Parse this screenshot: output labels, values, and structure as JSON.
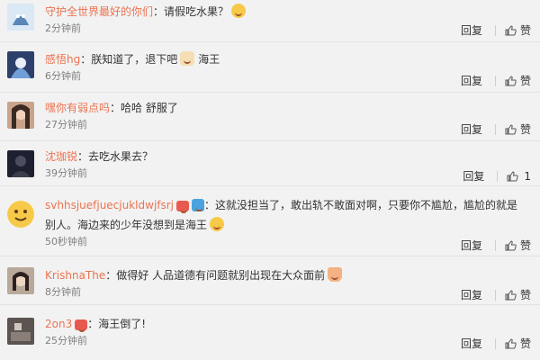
{
  "comments": [
    {
      "username": "守护全世界最好的你们",
      "text": "：请假吃水果？",
      "emojis": [
        "grin-emoji"
      ],
      "time": "2分钟前",
      "reply_label": "回复",
      "like_label": "赞",
      "avatar": "blue-cartoon-avatar"
    },
    {
      "username": "感悟hg",
      "text": "：朕知道了，退下吧",
      "emojis": [
        "dog-emoji"
      ],
      "text_after": "海王",
      "time": "6分钟前",
      "reply_label": "回复",
      "like_label": "赞",
      "avatar": "anime-avatar"
    },
    {
      "username": "嘿你有弱点吗",
      "text": "：哈哈 舒服了",
      "time": "27分钟前",
      "reply_label": "回复",
      "like_label": "赞",
      "avatar": "girl-avatar"
    },
    {
      "username": "沈珈锐",
      "text": "：去吃水果去？",
      "time": "39分钟前",
      "reply_label": "回复",
      "like_label": "",
      "like_count": "1",
      "avatar": "dark-avatar"
    },
    {
      "username": "svhhsjuefjuecjukldwjfsrj",
      "text": "：这就没担当了，敢出轨不敢面对啊，只要你不尴尬，尴尬的就是",
      "text_line2": "别人。海边来的少年没想到是海王",
      "time": "50秒钟前",
      "reply_label": "回复",
      "like_label": "赞",
      "avatar": "emoji-avatar"
    },
    {
      "username": "KrishnaThe",
      "text": "：做得好 人品道德有问题就别出现在大众面前",
      "time": "8分钟前",
      "reply_label": "回复",
      "like_label": "赞",
      "avatar": "girl2-avatar"
    },
    {
      "username": "2on3",
      "text": "：海王倒了!",
      "time": "25分钟前",
      "reply_label": "回复",
      "like_label": "赞",
      "avatar": "room-avatar"
    }
  ]
}
